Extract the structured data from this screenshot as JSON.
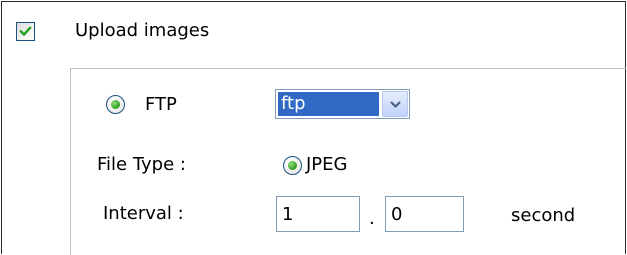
{
  "upload": {
    "checked": true,
    "label": "Upload images"
  },
  "protocol": {
    "selected": true,
    "label": "FTP",
    "select_value": "ftp"
  },
  "file_type": {
    "label": "File Type :",
    "option_selected": true,
    "option_label": "JPEG"
  },
  "interval": {
    "label": "Interval :",
    "seconds_value": "1",
    "separator": ".",
    "fraction_value": "0",
    "unit": "second"
  },
  "colors": {
    "selection": "#316ac5",
    "input_border": "#7f9db9",
    "radio_dot": "#2f9a1e",
    "check_mark": "#21a121"
  }
}
